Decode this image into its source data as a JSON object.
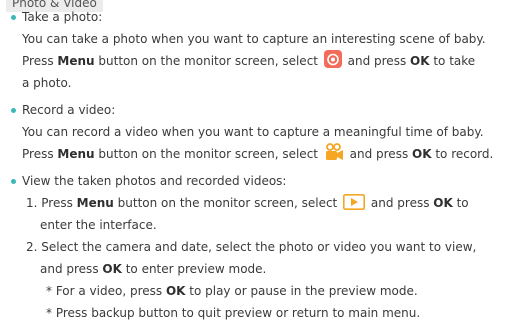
{
  "section_title": "Photo & Video",
  "photo": {
    "heading": "Take a photo:",
    "l1": "You can take a photo when you want to capture an interesting scene of baby.",
    "l2a": "Press ",
    "menu": "Menu",
    "l2b": " button on the monitor screen, select ",
    "l2c": " and press ",
    "ok": "OK",
    "l2d": " to take",
    "l3": "a photo."
  },
  "video": {
    "heading": "Record a video:",
    "l1": "You can record a video when you want to capture a meaningful time of baby.",
    "l2a": "Press ",
    "menu": "Menu",
    "l2b": " button on the monitor screen, select ",
    "l2c": " and press ",
    "ok": "OK",
    "l2d": " to record."
  },
  "view": {
    "heading": "View the taken photos and recorded videos:",
    "s1a": "1. Press ",
    "menu": "Menu",
    "s1b": " button on the monitor screen, select ",
    "s1c": " and press ",
    "ok": "OK",
    "s1d": " to",
    "s1e": "enter the interface.",
    "s2a": "2. Select the camera and date, select the photo or video you want to view,",
    "s2b": "and press ",
    "s2c": " to enter preview mode.",
    "n1a": "* For a video, press ",
    "n1b": " to play or pause in the preview mode.",
    "n2": "* Press backup button to quit preview or return to main menu."
  },
  "icons": {
    "camera": "camera-icon",
    "video": "video-camera-icon",
    "playback": "playback-icon"
  },
  "colors": {
    "accent": "#3ab8b8",
    "camera_icon": "#f26b5b",
    "video_icon": "#f5a623",
    "playback_icon": "#f5a623"
  }
}
